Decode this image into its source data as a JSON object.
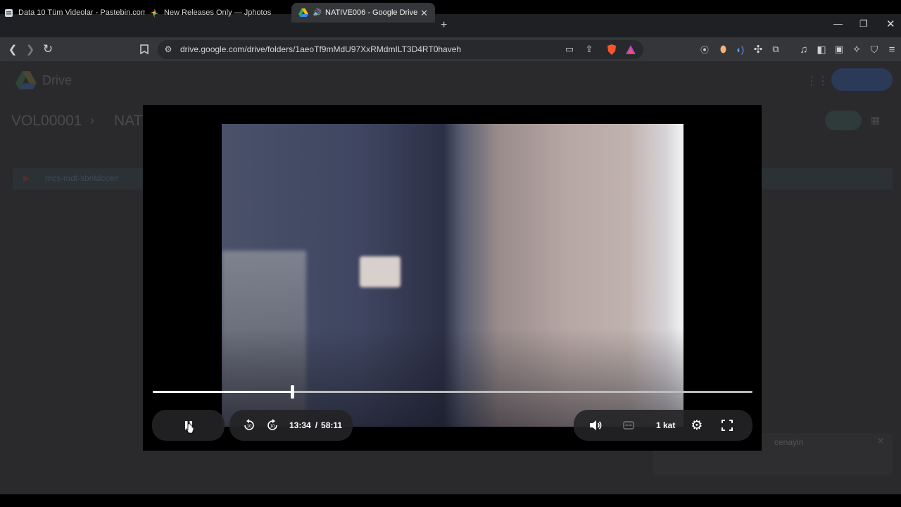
{
  "browser": {
    "tabs": [
      {
        "label": "Data 10 Tüm Videolar - Pastebin.com",
        "icon": "pastebin-icon"
      },
      {
        "label": "New Releases Only — Jphotos",
        "icon": "pinwheel-icon"
      },
      {
        "label": "NATIVE006 - Google Drive",
        "icon": "google-drive-icon",
        "active": true
      }
    ],
    "url": "drive.google.com/drive/folders/1aeoTf9mMdU97XxRMdmILT3D4RT0haveh"
  },
  "drive": {
    "app_name": "Drive",
    "breadcrumb": [
      "VOL00001",
      "NATI"
    ],
    "file_name": "mcs-mdt-sbntdccen",
    "toast_title": "cenayin"
  },
  "player": {
    "current_time": "13:34",
    "separator": "/",
    "duration": "58:11",
    "progress_fraction": 0.2326,
    "speed_label": "1 kat"
  }
}
